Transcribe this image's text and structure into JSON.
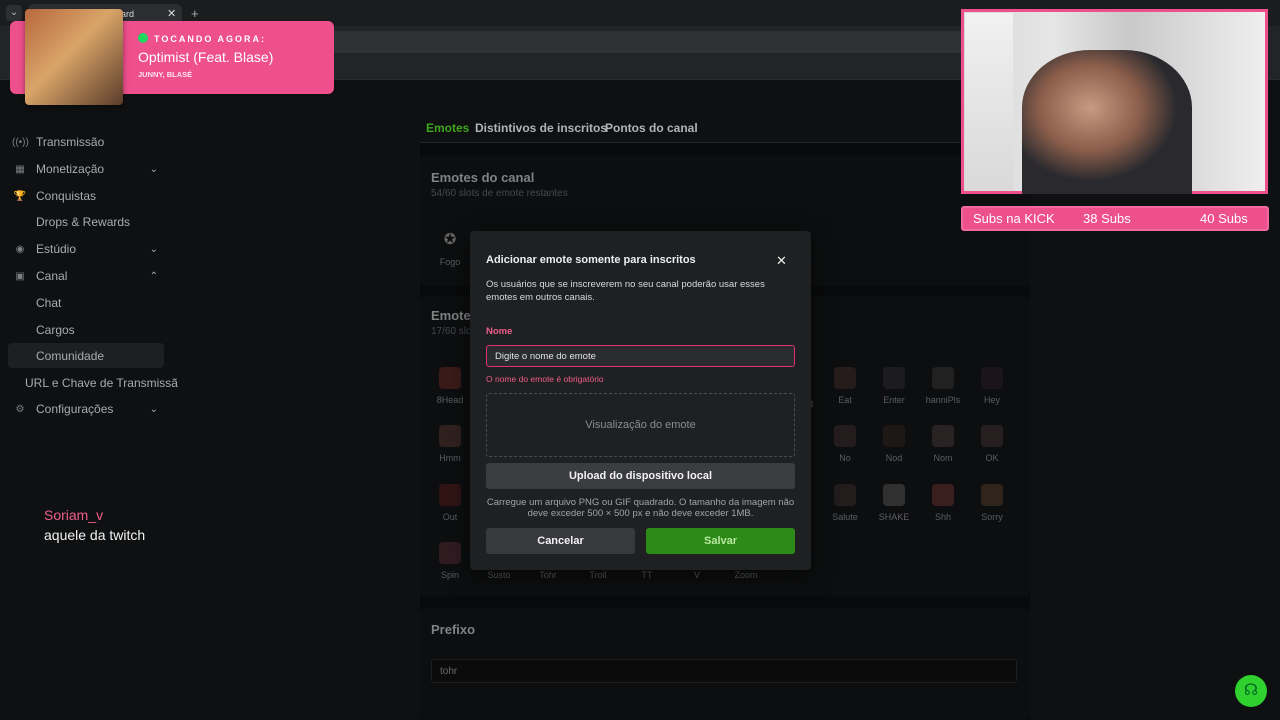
{
  "browser": {
    "tab_title": "oard",
    "tab_close": "✕",
    "tab_add": "+",
    "menu": "⌄"
  },
  "sidebar": {
    "items": [
      {
        "label": "Transmissão",
        "icon": "broadcast-icon",
        "glyph": "((•))"
      },
      {
        "label": "Monetização",
        "icon": "money-icon",
        "glyph": "▦",
        "chev": "⌄"
      },
      {
        "label": "Conquistas",
        "icon": "trophy-icon",
        "glyph": "🏆"
      },
      {
        "label": "Drops & Rewards",
        "icon": "drops-icon",
        "glyph": ""
      },
      {
        "label": "Estúdio",
        "icon": "studio-icon",
        "glyph": "◉",
        "chev": "⌄"
      },
      {
        "label": "Canal",
        "icon": "channel-icon",
        "glyph": "▣",
        "chev": "⌃"
      },
      {
        "label": "Configurações",
        "icon": "gear-icon",
        "glyph": "⚙",
        "chev": "⌄"
      }
    ],
    "sub": [
      "Chat",
      "Cargos",
      "Comunidade"
    ],
    "url_item": "URL e Chave de Transmissã"
  },
  "main": {
    "tabs": [
      "Emotes",
      "Distintivos de inscritos",
      "Pontos do canal"
    ],
    "channel_emotes": {
      "title": "Emotes do canal",
      "subtitle": "54/60 slots de emote restantes",
      "emote": "Fogo"
    },
    "sub_emotes": {
      "title": "Emotes",
      "subtitle": "17/60 slo",
      "items": [
        "8Head",
        "Eat",
        "Enter",
        "hanniPls",
        "Hey",
        "Hmm",
        "No",
        "Nod",
        "Nom",
        "OK",
        "Out",
        "Salute",
        "SHAKE",
        "Shh",
        "Sorry",
        "Spin",
        "Susto",
        "Tohr",
        "Troll",
        "TT",
        "V",
        "Zoom"
      ],
      "partial": "d"
    },
    "prefix": {
      "title": "Prefixo",
      "value": "tohr"
    }
  },
  "modal": {
    "title": "Adicionar emote somente para inscritos",
    "close": "✕",
    "description": "Os usuários que se inscreverem no seu canal poderão usar esses emotes em outros canais.",
    "name_label": "Nome",
    "name_placeholder": "Digite o nome do emote",
    "name_error": "O nome do emote é obrigatório",
    "preview": "Visualização do emote",
    "upload": "Upload do dispositivo local",
    "upload_help": "Carregue um arquivo PNG ou GIF quadrado. O tamanho da imagem não deve exceder 500 × 500 px e não deve exceder 1MB.",
    "cancel": "Cancelar",
    "save": "Salvar"
  },
  "now_playing": {
    "label": "TOCANDO AGORA:",
    "song": "Optimist (Feat. Blase)",
    "artist": "JUNNY, BLASÉ"
  },
  "subs": {
    "label": "Subs na KICK",
    "current": "38 Subs",
    "goal": "40 Subs",
    "progress": 0.95
  },
  "streamer": {
    "name": "Soriam_v",
    "tagline": "aquele da twitch"
  },
  "colors": {
    "accent": "#53fc18",
    "pink": "#ee4f8d",
    "error": "#e0336b"
  }
}
